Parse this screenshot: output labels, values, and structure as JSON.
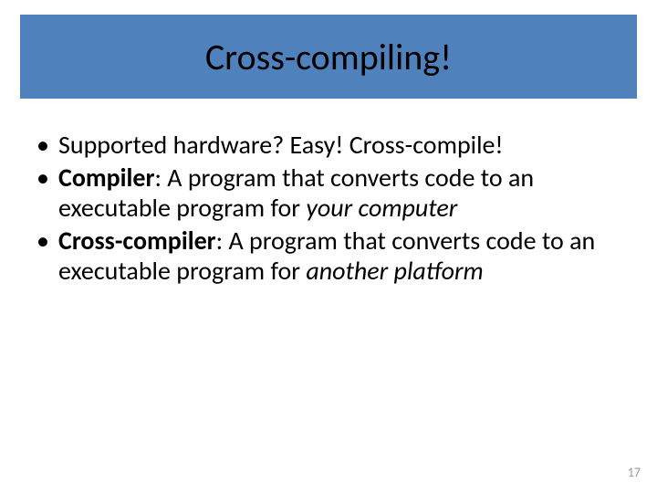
{
  "title": "Cross-compiling!",
  "bullets": {
    "b0": {
      "bold": "",
      "plain": "Supported hardware? Easy! Cross-compile!",
      "italic": ""
    },
    "b1": {
      "bold": "Compiler",
      "plain": ": A program that converts code to an executable program for ",
      "italic": "your computer"
    },
    "b2": {
      "bold": "Cross-compiler",
      "plain": ": A program that converts code to an executable program for ",
      "italic": "another platform"
    }
  },
  "pageNumber": "17",
  "bulletChar": "•"
}
